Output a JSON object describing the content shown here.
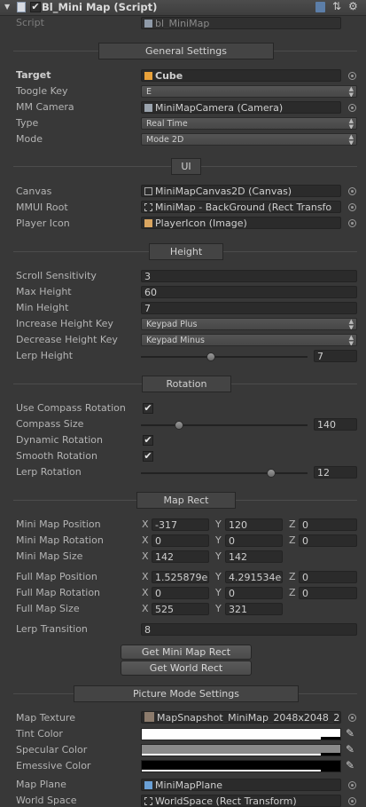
{
  "header": {
    "title": "Bl_Mini Map (Script)"
  },
  "script_row": {
    "label": "Script",
    "value": "bl_MiniMap"
  },
  "general": {
    "section_title": "General Settings",
    "target": {
      "label": "Target",
      "value": "Cube"
    },
    "toggle_key": {
      "label": "Toogle Key",
      "value": "E"
    },
    "mm_camera": {
      "label": "MM Camera",
      "value": "MiniMapCamera (Camera)"
    },
    "type": {
      "label": "Type",
      "value": "Real Time"
    },
    "mode": {
      "label": "Mode",
      "value": "Mode 2D"
    }
  },
  "ui": {
    "section_title": "UI",
    "canvas": {
      "label": "Canvas",
      "value": "MiniMapCanvas2D (Canvas)"
    },
    "mmui_root": {
      "label": "MMUI Root",
      "value": "MiniMap - BackGround (Rect Transfo"
    },
    "player_icon": {
      "label": "Player Icon",
      "value": "PlayerIcon (Image)"
    }
  },
  "height": {
    "section_title": "Height",
    "scroll_sensitivity": {
      "label": "Scroll Sensitivity",
      "value": "3"
    },
    "max_height": {
      "label": "Max Height",
      "value": "60"
    },
    "min_height": {
      "label": "Min Height",
      "value": "7"
    },
    "increase_key": {
      "label": "Increase Height Key",
      "value": "Keypad Plus"
    },
    "decrease_key": {
      "label": "Decrease Height Key",
      "value": "Keypad Minus"
    },
    "lerp_height": {
      "label": "Lerp Height",
      "value": "7"
    }
  },
  "rotation": {
    "section_title": "Rotation",
    "use_compass": {
      "label": "Use Compass Rotation",
      "checked": true
    },
    "compass_size": {
      "label": "Compass Size",
      "value": "140"
    },
    "dynamic_rotation": {
      "label": "Dynamic Rotation",
      "checked": true
    },
    "smooth_rotation": {
      "label": "Smooth Rotation",
      "checked": true
    },
    "lerp_rotation": {
      "label": "Lerp Rotation",
      "value": "12"
    }
  },
  "map_rect": {
    "section_title": "Map Rect",
    "mini_position": {
      "label": "Mini Map Position",
      "x": "-317",
      "y": "120",
      "z": "0"
    },
    "mini_rotation": {
      "label": "Mini Map Rotation",
      "x": "0",
      "y": "0",
      "z": "0"
    },
    "mini_size": {
      "label": "Mini Map Size",
      "x": "142",
      "y": "142"
    },
    "full_position": {
      "label": "Full Map Position",
      "x": "1.525879e",
      "y": "4.291534e-",
      "z": "0"
    },
    "full_rotation": {
      "label": "Full Map Rotation",
      "x": "0",
      "y": "0",
      "z": "0"
    },
    "full_size": {
      "label": "Full Map Size",
      "x": "525",
      "y": "321"
    },
    "lerp_transition": {
      "label": "Lerp Transition",
      "value": "8"
    },
    "get_mini_button": "Get Mini Map Rect",
    "get_world_button": "Get World Rect"
  },
  "picture": {
    "section_title": "Picture Mode Settings",
    "map_texture": {
      "label": "Map Texture",
      "value": "MapSnapshot_MiniMap_2048x2048_2"
    },
    "tint_color": {
      "label": "Tint Color",
      "color": "#ffffff"
    },
    "specular_color": {
      "label": "Specular Color",
      "color": "#8a8a8a"
    },
    "emissive_color": {
      "label": "Emessive Color",
      "color": "#000000"
    },
    "map_plane": {
      "label": "Map Plane",
      "value": "MiniMapPlane"
    },
    "world_space": {
      "label": "World Space",
      "value": "WorldSpace (Rect Transform)"
    }
  },
  "axes": {
    "x": "X",
    "y": "Y",
    "z": "Z"
  },
  "sliders": {
    "lerp_height_fraction": 0.42,
    "compass_size_fraction": 0.23,
    "lerp_rotation_fraction": 0.78
  }
}
